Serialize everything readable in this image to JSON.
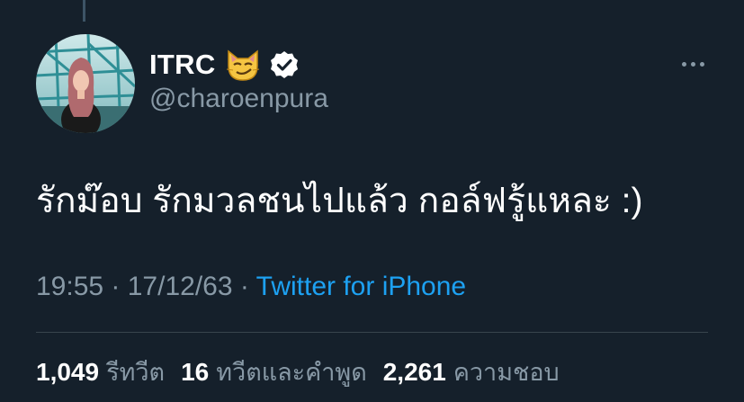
{
  "tweet": {
    "author": {
      "display_name": "ITRC",
      "emoji_icon": "smirking-cat-face-icon",
      "verified_icon": "verified-badge-icon",
      "handle": "@charoenpura"
    },
    "text": "รักม๊อบ รักมวลชนไปแล้ว กอล์ฟรู้แหละ :)",
    "time": "19:55",
    "separator": "·",
    "date": "17/12/63",
    "source": "Twitter for iPhone",
    "stats": [
      {
        "count": "1,049",
        "label": "รีทวีต"
      },
      {
        "count": "16",
        "label": "ทวีตและคำพูด"
      },
      {
        "count": "2,261",
        "label": "ความชอบ"
      }
    ]
  },
  "colors": {
    "background": "#15202b",
    "primary_text": "#ffffff",
    "secondary_text": "#8899a6",
    "link": "#1da1f2",
    "divider": "#38444d"
  }
}
